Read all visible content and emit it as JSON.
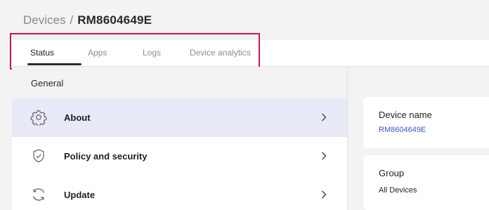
{
  "breadcrumb": {
    "parent": "Devices",
    "separator": "/",
    "current": "RM8604649E"
  },
  "tabs": [
    {
      "label": "Status",
      "active": true
    },
    {
      "label": "Apps",
      "active": false
    },
    {
      "label": "Logs",
      "active": false
    },
    {
      "label": "Device analytics",
      "active": false
    }
  ],
  "settings_menu": {
    "section_title": "General",
    "items": [
      {
        "label": "About",
        "icon": "gear-icon",
        "selected": true
      },
      {
        "label": "Policy and security",
        "icon": "shield-check-icon",
        "selected": false
      },
      {
        "label": "Update",
        "icon": "refresh-icon",
        "selected": false
      }
    ]
  },
  "details": {
    "device_name": {
      "title": "Device name",
      "value": "RM8604649E"
    },
    "group": {
      "title": "Group",
      "value": "All Devices"
    }
  },
  "colors": {
    "accent_highlight": "#c5194a",
    "link": "#3a59c7",
    "selected_row": "#e9eaf8"
  }
}
